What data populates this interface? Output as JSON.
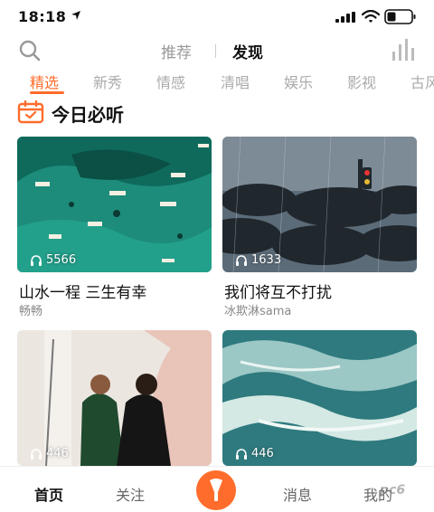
{
  "status_bar": {
    "time": "18:18"
  },
  "header": {
    "tabs": [
      {
        "label": "推荐"
      },
      {
        "label": "发现"
      }
    ]
  },
  "categories": [
    "精选",
    "新秀",
    "情感",
    "清唱",
    "娱乐",
    "影视",
    "古风"
  ],
  "section": {
    "title": "今日必听"
  },
  "cards": [
    {
      "title": "山水一程 三生有幸",
      "user": "畅畅",
      "plays": "5566",
      "image": "aerial-boats-green-sea"
    },
    {
      "title": "我们将互不打扰",
      "user": "冰欺淋sama",
      "plays": "1633",
      "image": "umbrellas-in-rain"
    },
    {
      "title": "",
      "user": "",
      "plays": "446",
      "image": "couple-in-archway"
    },
    {
      "title": "",
      "user": "",
      "plays": "446",
      "image": "ocean-waves"
    }
  ],
  "bottom_nav": {
    "items": [
      {
        "label": "首页"
      },
      {
        "label": "关注"
      },
      {
        "label": "消息"
      },
      {
        "label": "我的"
      }
    ]
  },
  "watermark": "pc6",
  "colors": {
    "accent": "#ff6c2b",
    "inactive_text": "#aaaaaa"
  }
}
